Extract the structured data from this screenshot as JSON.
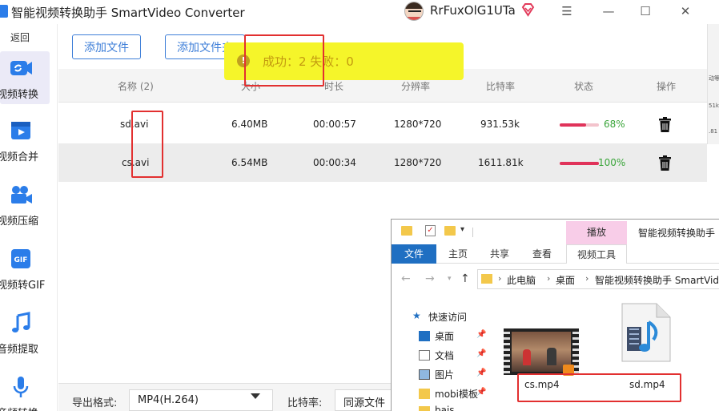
{
  "app": {
    "title": "智能视频转换助手 SmartVideo Converter"
  },
  "user": {
    "name": "RrFuxOlG1UTa"
  },
  "sidebar": {
    "back_label": "返回",
    "items": [
      {
        "label": "视频转换",
        "icon": "video-convert-icon",
        "active": true
      },
      {
        "label": "视频合并",
        "icon": "video-merge-icon",
        "active": false
      },
      {
        "label": "视频压缩",
        "icon": "video-compress-icon",
        "active": false
      },
      {
        "label": "视频转GIF",
        "icon": "gif-icon",
        "active": false
      },
      {
        "label": "音频提取",
        "icon": "music-note-icon",
        "active": false
      },
      {
        "label": "音频转换",
        "icon": "microphone-icon",
        "active": false
      }
    ]
  },
  "toolbar": {
    "add_file": "添加文件",
    "add_folder": "添加文件夹"
  },
  "toast": {
    "text": "成功：2   失败：0"
  },
  "table": {
    "headers": {
      "name": "名称 (2)",
      "size": "大小",
      "duration": "时长",
      "resolution": "分辨率",
      "bitrate": "比特率",
      "status": "状态",
      "action": "操作"
    },
    "rows": [
      {
        "name": "sd.avi",
        "size": "6.40MB",
        "duration": "00:00:57",
        "resolution": "1280*720",
        "bitrate": "931.53k",
        "progress_pct": 68,
        "progress_label": "68%"
      },
      {
        "name": "cs.avi",
        "size": "6.54MB",
        "duration": "00:00:34",
        "resolution": "1280*720",
        "bitrate": "1611.81k",
        "progress_pct": 100,
        "progress_label": "100%"
      }
    ]
  },
  "strip": {
    "t1": "动等",
    "t2": "51k",
    "t3": ".81"
  },
  "bottom": {
    "format_label": "导出格式:",
    "format_value": "MP4(H.264)",
    "bitrate_label": "比特率:",
    "bitrate_value": "同源文件"
  },
  "explorer": {
    "title": "智能视频转换助手",
    "context_tab": "播放",
    "ribbon_tabs": [
      "文件",
      "主页",
      "共享",
      "查看",
      "视频工具"
    ],
    "address": [
      "此电脑",
      "桌面",
      "智能视频转换助手 SmartVide"
    ],
    "nav_items": [
      "快速访问",
      "桌面",
      "文档",
      "图片",
      "mobi模板",
      "bais"
    ],
    "files": [
      "cs.mp4",
      "sd.mp4"
    ]
  },
  "colors": {
    "accent": "#3f7fd8",
    "progress": "#e0335a",
    "success": "#3aa53a",
    "toast": "#f5f52a",
    "highlight": "#e23030"
  }
}
